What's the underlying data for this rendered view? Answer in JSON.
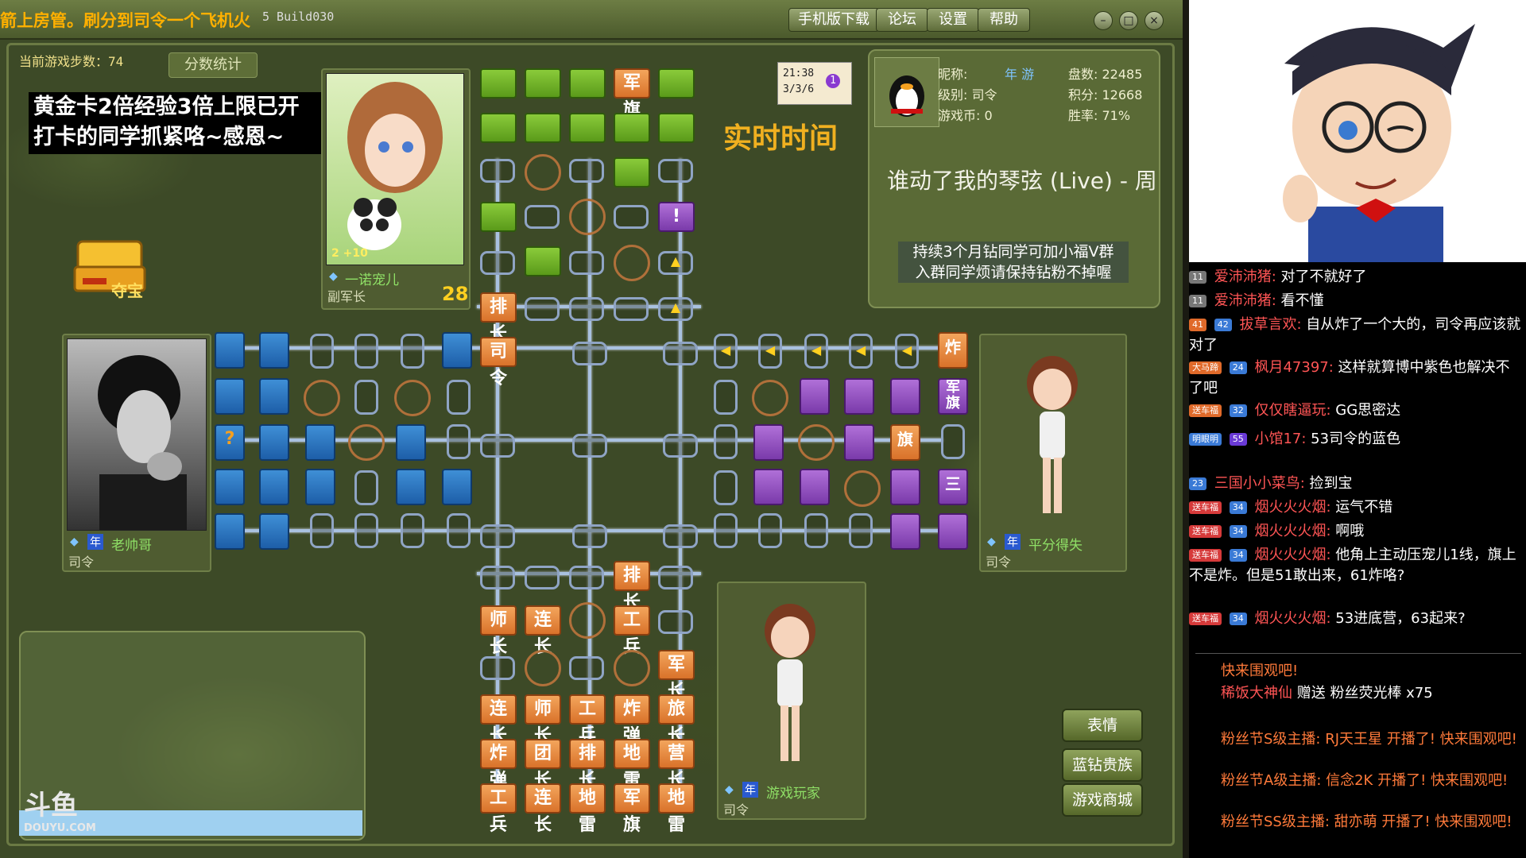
{
  "titlebar": {
    "scroll_text": "箭上房管。刷分到司令一个飞机火",
    "build": "5 Build030",
    "buttons": [
      "手机版下载",
      "论坛",
      "设置",
      "帮助"
    ]
  },
  "game": {
    "steps_label": "当前游戏步数：74",
    "stats_button": "分数统计",
    "notice_line1": "黄金卡2倍经验3倍上限已开",
    "notice_line2": "打卡的同学抓紧咯~感恩~",
    "treasure_label": "夺宝",
    "clock_time": "21:38",
    "clock_date": "3/3/6",
    "clock_badge": "1",
    "realtime_label": "实时时间",
    "song": "谁动了我的琴弦 (Live) - 周",
    "vip_line1": "持续3个月钻同学可加小福V群",
    "vip_line2": "入群同学烦请保持钻粉不掉喔",
    "turn_timer": "28",
    "emoji_button": "表情",
    "blue_diamond_button": "蓝钻贵族",
    "shop_button": "游戏商城"
  },
  "profile": {
    "nickname_label": "昵称:",
    "nickname_tag": "年 游",
    "level": "级别: 司令",
    "coins": "游戏币: 0",
    "games": "盘数: 22485",
    "score": "积分: 12668",
    "winrate": "胜率: 71%"
  },
  "players": {
    "top": {
      "name": "一诺宠儿",
      "rank": "副军长",
      "level_tag": "2 +10"
    },
    "left": {
      "name": "老帅哥",
      "rank": "司令",
      "tag": "年"
    },
    "right": {
      "name": "平分得失",
      "rank": "司令",
      "tag": "年"
    },
    "bottom": {
      "name": "游戏玩家",
      "rank": "司令",
      "tag": "年"
    }
  },
  "pieces": {
    "top_flag": "军旗",
    "top_unknown": "!",
    "top_pai": "排长",
    "siling": "司令",
    "bottom_row1": [
      "排长"
    ],
    "bottom_row2": [
      "师长",
      "连长",
      "工兵"
    ],
    "bottom_row3": [
      "军长"
    ],
    "bottom_row4": [
      "连长",
      "师长",
      "工兵",
      "炸弹",
      "旅长"
    ],
    "bottom_row5": [
      "炸弹",
      "团长",
      "排长",
      "地雷",
      "营长"
    ],
    "bottom_row6": [
      "工兵",
      "连长",
      "地雷",
      "军旗",
      "地雷"
    ],
    "left_unknown": "?",
    "right_zha": "炸",
    "right_junqi": "军旗",
    "right_qi": "旗",
    "right_three": "三"
  },
  "chat": [
    {
      "badges": [
        "11"
      ],
      "user": "爱沛沛猪:",
      "text": "对了不就好了"
    },
    {
      "badges": [
        "11"
      ],
      "user": "爱沛沛猪:",
      "text": "看不懂"
    },
    {
      "badges": [
        "41",
        "42"
      ],
      "user": "拔草言欢:",
      "text": "自从炸了一个大的，司令再应该就对了"
    },
    {
      "badges": [
        "大马蹄",
        "24"
      ],
      "user": "枫月47397:",
      "text": "这样就算博中紫色也解决不了吧"
    },
    {
      "badges": [
        "送车福",
        "32"
      ],
      "user": "仅仅瞎逼玩:",
      "text": "GG思密达"
    },
    {
      "badges": [
        "明眼明",
        "55"
      ],
      "user": "小馆17:",
      "text": "53司令的蓝色"
    },
    {
      "badges": [
        "23"
      ],
      "user": "三国小小菜鸟:",
      "text": "捡到宝"
    },
    {
      "badges": [
        "送车福",
        "34"
      ],
      "user": "烟火火火烟:",
      "text": "运气不错"
    },
    {
      "badges": [
        "送车福",
        "34"
      ],
      "user": "烟火火火烟:",
      "text": "啊哦"
    },
    {
      "badges": [
        "送车福",
        "34"
      ],
      "user": "烟火火火烟:",
      "text": "他角上主动压宠儿1线，旗上不是炸。但是51敢出来，61炸咯?"
    },
    {
      "badges": [
        "送车福",
        "34"
      ],
      "user": "烟火火火烟:",
      "text": "53进底营，63起来?"
    }
  ],
  "system": [
    {
      "text": "快来围观吧!"
    },
    {
      "user": "稀饭大神仙",
      "text": "赠送 粉丝荧光棒 x75"
    },
    {
      "text": "粉丝节S级主播: RJ天王星 开播了! 快来围观吧!"
    },
    {
      "text": "粉丝节A级主播: 信念2K 开播了! 快来围观吧!"
    },
    {
      "text": "粉丝节SS级主播: 甜亦萌 开播了! 快来围观吧!"
    }
  ],
  "watermark": {
    "brand": "斗鱼",
    "url": "DOUYU.COM"
  },
  "colors": {
    "accent": "#f0b020",
    "blue_side": "#1d5ea8",
    "purple_side": "#7a3aaa",
    "green_side": "#5a9a1a",
    "orange_side": "#d9722a"
  }
}
